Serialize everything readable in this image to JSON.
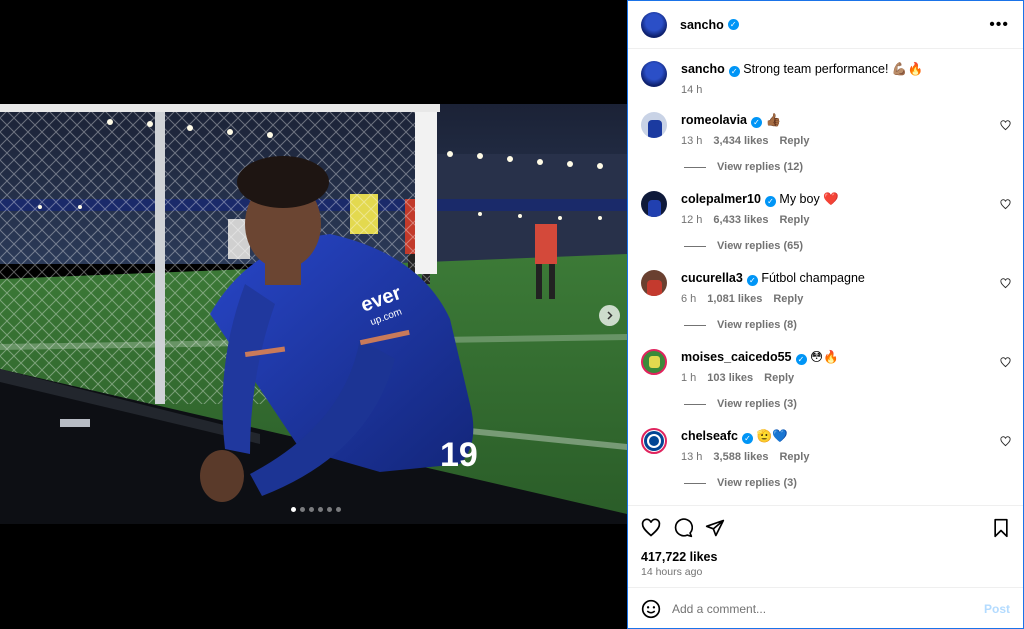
{
  "post": {
    "author": "sancho",
    "caption": "Strong team performance! 💪🏽🔥",
    "caption_time": "14 h",
    "likes": "417,722 likes",
    "posted_ago": "14 hours ago",
    "carousel_count": 6,
    "carousel_index": 1
  },
  "comments": [
    {
      "user": "romeolavia",
      "text": "👍🏾",
      "time": "13 h",
      "likes": "3,434 likes",
      "reply": "Reply",
      "replies": "View replies (12)"
    },
    {
      "user": "colepalmer10",
      "text": "My boy ❤️",
      "time": "12 h",
      "likes": "6,433 likes",
      "reply": "Reply",
      "replies": "View replies (65)"
    },
    {
      "user": "cucurella3",
      "text": "Fútbol champagne",
      "time": "6 h",
      "likes": "1,081 likes",
      "reply": "Reply",
      "replies": "View replies (8)"
    },
    {
      "user": "moises_caicedo55",
      "text": "😳🔥",
      "time": "1 h",
      "likes": "103 likes",
      "reply": "Reply",
      "replies": "View replies (3)"
    },
    {
      "user": "chelseafc",
      "text": "🫡💙",
      "time": "13 h",
      "likes": "3,588 likes",
      "reply": "Reply",
      "replies": "View replies (3)"
    }
  ],
  "composer": {
    "placeholder": "Add a comment...",
    "post_label": "Post"
  },
  "jersey": {
    "sponsor": "ever",
    "sponsor_sub": "up.com",
    "number": "19"
  },
  "colors": {
    "accent": "#0095f6",
    "chelsea_blue": "#1a3fa8",
    "verified": "#0095f6"
  }
}
